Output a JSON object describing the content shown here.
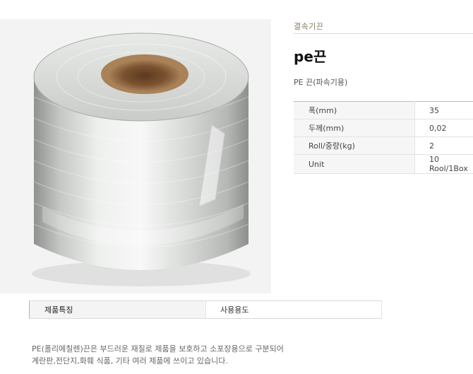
{
  "category_label": "결속기끈",
  "product": {
    "name": "pe끈",
    "subtitle": "PE 끈(파속기용)"
  },
  "specs": [
    {
      "label": "폭(mm)",
      "value": "35"
    },
    {
      "label": "두께(mm)",
      "value": "0,02"
    },
    {
      "label": "Roll/중량(kg)",
      "value": "2"
    },
    {
      "label": "Unit",
      "value": "10 Rool/1Box"
    }
  ],
  "tabs": {
    "features_label": "제품특징",
    "uses_label": "사용용도"
  },
  "description": {
    "line1": "PE(폴리에칠렌)끈은 부드러운 재질로 제품을 보호하고 소포장용으로 구분되어",
    "line2": "계란판,전단지,화훼 식품, 기타 여러 제품에 쓰이고 있습니다."
  }
}
